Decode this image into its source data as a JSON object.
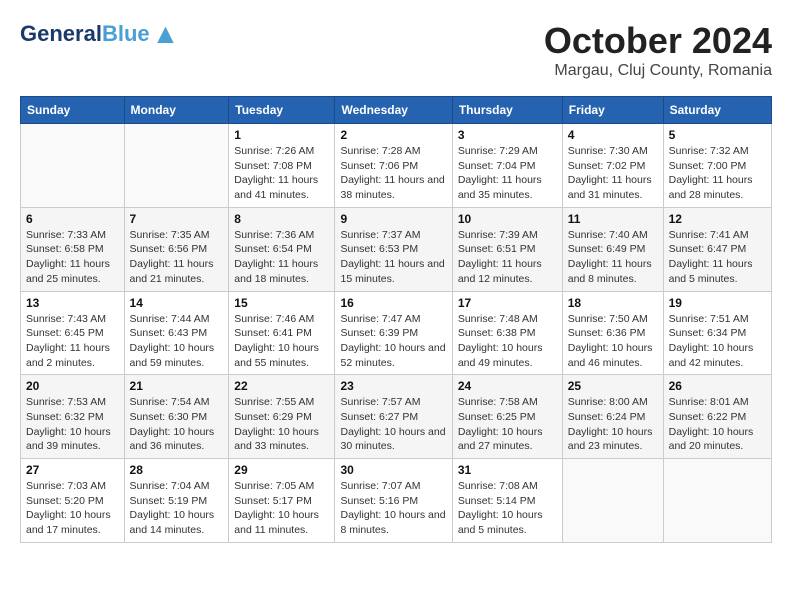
{
  "header": {
    "logo": {
      "line1": "General",
      "line2": "Blue",
      "bird": "▲"
    },
    "title": "October 2024",
    "subtitle": "Margau, Cluj County, Romania"
  },
  "calendar": {
    "weekdays": [
      "Sunday",
      "Monday",
      "Tuesday",
      "Wednesday",
      "Thursday",
      "Friday",
      "Saturday"
    ],
    "weeks": [
      [
        {
          "day": "",
          "info": ""
        },
        {
          "day": "",
          "info": ""
        },
        {
          "day": "1",
          "info": "Sunrise: 7:26 AM\nSunset: 7:08 PM\nDaylight: 11 hours and 41 minutes."
        },
        {
          "day": "2",
          "info": "Sunrise: 7:28 AM\nSunset: 7:06 PM\nDaylight: 11 hours and 38 minutes."
        },
        {
          "day": "3",
          "info": "Sunrise: 7:29 AM\nSunset: 7:04 PM\nDaylight: 11 hours and 35 minutes."
        },
        {
          "day": "4",
          "info": "Sunrise: 7:30 AM\nSunset: 7:02 PM\nDaylight: 11 hours and 31 minutes."
        },
        {
          "day": "5",
          "info": "Sunrise: 7:32 AM\nSunset: 7:00 PM\nDaylight: 11 hours and 28 minutes."
        }
      ],
      [
        {
          "day": "6",
          "info": "Sunrise: 7:33 AM\nSunset: 6:58 PM\nDaylight: 11 hours and 25 minutes."
        },
        {
          "day": "7",
          "info": "Sunrise: 7:35 AM\nSunset: 6:56 PM\nDaylight: 11 hours and 21 minutes."
        },
        {
          "day": "8",
          "info": "Sunrise: 7:36 AM\nSunset: 6:54 PM\nDaylight: 11 hours and 18 minutes."
        },
        {
          "day": "9",
          "info": "Sunrise: 7:37 AM\nSunset: 6:53 PM\nDaylight: 11 hours and 15 minutes."
        },
        {
          "day": "10",
          "info": "Sunrise: 7:39 AM\nSunset: 6:51 PM\nDaylight: 11 hours and 12 minutes."
        },
        {
          "day": "11",
          "info": "Sunrise: 7:40 AM\nSunset: 6:49 PM\nDaylight: 11 hours and 8 minutes."
        },
        {
          "day": "12",
          "info": "Sunrise: 7:41 AM\nSunset: 6:47 PM\nDaylight: 11 hours and 5 minutes."
        }
      ],
      [
        {
          "day": "13",
          "info": "Sunrise: 7:43 AM\nSunset: 6:45 PM\nDaylight: 11 hours and 2 minutes."
        },
        {
          "day": "14",
          "info": "Sunrise: 7:44 AM\nSunset: 6:43 PM\nDaylight: 10 hours and 59 minutes."
        },
        {
          "day": "15",
          "info": "Sunrise: 7:46 AM\nSunset: 6:41 PM\nDaylight: 10 hours and 55 minutes."
        },
        {
          "day": "16",
          "info": "Sunrise: 7:47 AM\nSunset: 6:39 PM\nDaylight: 10 hours and 52 minutes."
        },
        {
          "day": "17",
          "info": "Sunrise: 7:48 AM\nSunset: 6:38 PM\nDaylight: 10 hours and 49 minutes."
        },
        {
          "day": "18",
          "info": "Sunrise: 7:50 AM\nSunset: 6:36 PM\nDaylight: 10 hours and 46 minutes."
        },
        {
          "day": "19",
          "info": "Sunrise: 7:51 AM\nSunset: 6:34 PM\nDaylight: 10 hours and 42 minutes."
        }
      ],
      [
        {
          "day": "20",
          "info": "Sunrise: 7:53 AM\nSunset: 6:32 PM\nDaylight: 10 hours and 39 minutes."
        },
        {
          "day": "21",
          "info": "Sunrise: 7:54 AM\nSunset: 6:30 PM\nDaylight: 10 hours and 36 minutes."
        },
        {
          "day": "22",
          "info": "Sunrise: 7:55 AM\nSunset: 6:29 PM\nDaylight: 10 hours and 33 minutes."
        },
        {
          "day": "23",
          "info": "Sunrise: 7:57 AM\nSunset: 6:27 PM\nDaylight: 10 hours and 30 minutes."
        },
        {
          "day": "24",
          "info": "Sunrise: 7:58 AM\nSunset: 6:25 PM\nDaylight: 10 hours and 27 minutes."
        },
        {
          "day": "25",
          "info": "Sunrise: 8:00 AM\nSunset: 6:24 PM\nDaylight: 10 hours and 23 minutes."
        },
        {
          "day": "26",
          "info": "Sunrise: 8:01 AM\nSunset: 6:22 PM\nDaylight: 10 hours and 20 minutes."
        }
      ],
      [
        {
          "day": "27",
          "info": "Sunrise: 7:03 AM\nSunset: 5:20 PM\nDaylight: 10 hours and 17 minutes."
        },
        {
          "day": "28",
          "info": "Sunrise: 7:04 AM\nSunset: 5:19 PM\nDaylight: 10 hours and 14 minutes."
        },
        {
          "day": "29",
          "info": "Sunrise: 7:05 AM\nSunset: 5:17 PM\nDaylight: 10 hours and 11 minutes."
        },
        {
          "day": "30",
          "info": "Sunrise: 7:07 AM\nSunset: 5:16 PM\nDaylight: 10 hours and 8 minutes."
        },
        {
          "day": "31",
          "info": "Sunrise: 7:08 AM\nSunset: 5:14 PM\nDaylight: 10 hours and 5 minutes."
        },
        {
          "day": "",
          "info": ""
        },
        {
          "day": "",
          "info": ""
        }
      ]
    ]
  }
}
